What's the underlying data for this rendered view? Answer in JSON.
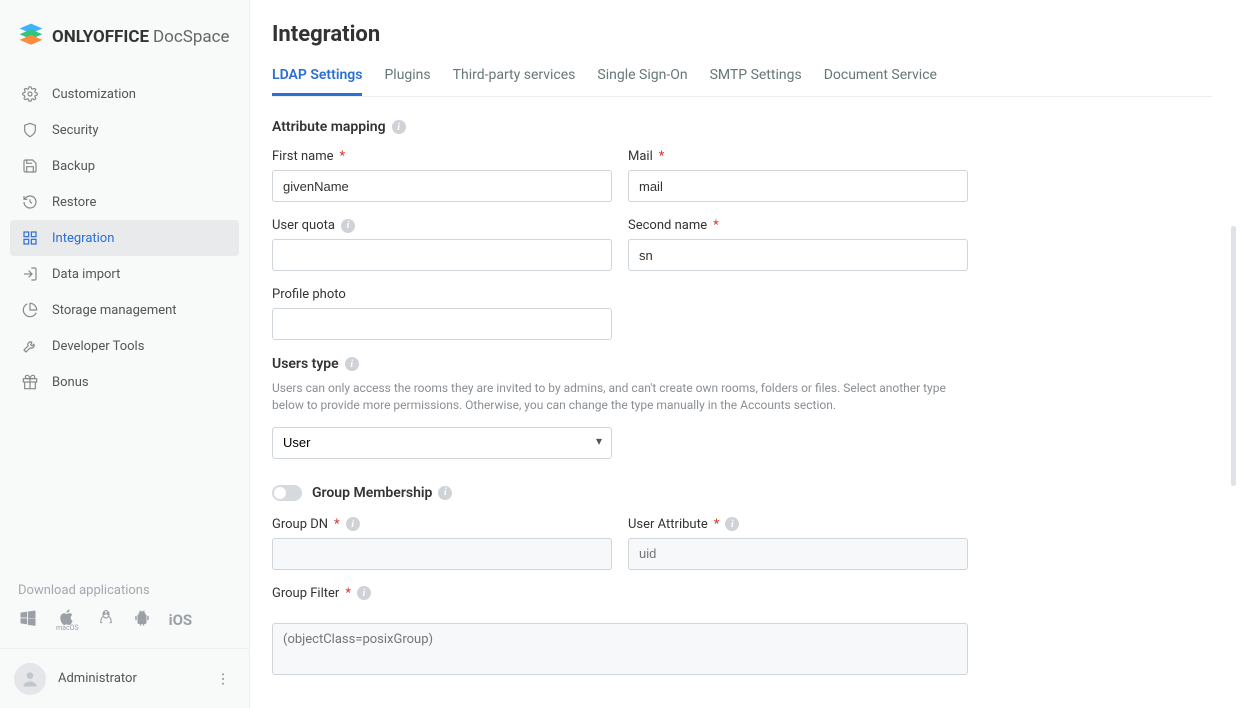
{
  "brand": {
    "name": "ONLYOFFICE",
    "subname": "DocSpace"
  },
  "sidebar": {
    "items": [
      {
        "label": "Customization"
      },
      {
        "label": "Security"
      },
      {
        "label": "Backup"
      },
      {
        "label": "Restore"
      },
      {
        "label": "Integration"
      },
      {
        "label": "Data import"
      },
      {
        "label": "Storage management"
      },
      {
        "label": "Developer Tools"
      },
      {
        "label": "Bonus"
      }
    ],
    "download_title": "Download applications"
  },
  "profile": {
    "name": "Administrator"
  },
  "page": {
    "title": "Integration"
  },
  "tabs": [
    {
      "label": "LDAP Settings"
    },
    {
      "label": "Plugins"
    },
    {
      "label": "Third-party services"
    },
    {
      "label": "Single Sign-On"
    },
    {
      "label": "SMTP Settings"
    },
    {
      "label": "Document Service"
    }
  ],
  "sections": {
    "attribute_mapping": {
      "title": "Attribute mapping"
    },
    "users_type": {
      "title": "Users type",
      "helper": "Users can only access the rooms they are invited to by admins, and can't create own rooms, folders or files. Select another type below to provide more permissions. Otherwise, you can change the type manually in the Accounts section.",
      "selected": "User"
    },
    "group_membership": {
      "title": "Group Membership"
    }
  },
  "fields": {
    "first_name": {
      "label": "First name",
      "value": "givenName"
    },
    "mail": {
      "label": "Mail",
      "value": "mail"
    },
    "user_quota": {
      "label": "User quota",
      "value": ""
    },
    "second_name": {
      "label": "Second name",
      "value": "sn"
    },
    "profile_photo": {
      "label": "Profile photo",
      "value": ""
    },
    "group_dn": {
      "label": "Group DN",
      "value": ""
    },
    "user_attribute": {
      "label": "User Attribute",
      "placeholder": "uid",
      "value": ""
    },
    "group_filter": {
      "label": "Group Filter",
      "placeholder": "(objectClass=posixGroup)",
      "value": ""
    }
  }
}
